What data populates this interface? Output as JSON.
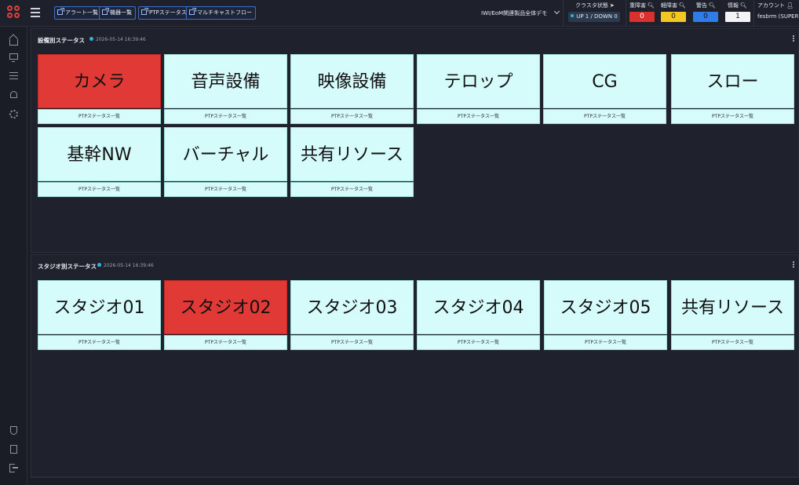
{
  "topbar": {
    "nav_buttons": [
      "アラート一覧",
      "機器一覧",
      "PTPステータス",
      "マルチキャストフロー"
    ],
    "scope_select": "IWI/EoM関連製品全体デモ",
    "cluster_label": "クラスタ状態",
    "cluster_value": "UP 1 / DOWN 0",
    "severity": [
      {
        "label": "重障害",
        "value": "0",
        "color": "#d9322e"
      },
      {
        "label": "軽障害",
        "value": "0",
        "color": "#f3c623"
      },
      {
        "label": "警告",
        "value": "0",
        "color": "#2f7ce6"
      },
      {
        "label": "情報",
        "value": "1",
        "color": "#f4f4f6"
      }
    ],
    "account_label": "アカウント",
    "account_name": "fesbrm (SUPER)"
  },
  "sidebar": {
    "icons": [
      "home-icon",
      "monitor-icon",
      "list-icon",
      "bell-icon",
      "gear-icon",
      "shield-icon",
      "document-icon",
      "logout-icon"
    ]
  },
  "equipment_panel": {
    "title": "設備別ステータス",
    "timestamp": "2026-05-14 16:39:46",
    "tiles": [
      {
        "label": "カメラ",
        "sub": "PTPステータス一覧",
        "alarm": true
      },
      {
        "label": "音声設備",
        "sub": "PTPステータス一覧",
        "alarm": false
      },
      {
        "label": "映像設備",
        "sub": "PTPステータス一覧",
        "alarm": false
      },
      {
        "label": "テロップ",
        "sub": "PTPステータス一覧",
        "alarm": false
      },
      {
        "label": "CG",
        "sub": "PTPステータス一覧",
        "alarm": false
      },
      {
        "label": "スロー",
        "sub": "PTPステータス一覧",
        "alarm": false
      },
      {
        "label": "基幹NW",
        "sub": "PTPステータス一覧",
        "alarm": false
      },
      {
        "label": "バーチャル",
        "sub": "PTPステータス一覧",
        "alarm": false
      },
      {
        "label": "共有リソース",
        "sub": "PTPステータス一覧",
        "alarm": false
      }
    ]
  },
  "studio_panel": {
    "title": "スタジオ別ステータス",
    "timestamp": "2026-05-14 16:39:46",
    "tiles": [
      {
        "label": "スタジオ01",
        "sub": "PTPステータス一覧",
        "alarm": false
      },
      {
        "label": "スタジオ02",
        "sub": "PTPステータス一覧",
        "alarm": true
      },
      {
        "label": "スタジオ03",
        "sub": "PTPステータス一覧",
        "alarm": false
      },
      {
        "label": "スタジオ04",
        "sub": "PTPステータス一覧",
        "alarm": false
      },
      {
        "label": "スタジオ05",
        "sub": "PTPステータス一覧",
        "alarm": false
      },
      {
        "label": "共有リソース",
        "sub": "PTPステータス一覧",
        "alarm": false
      }
    ]
  }
}
